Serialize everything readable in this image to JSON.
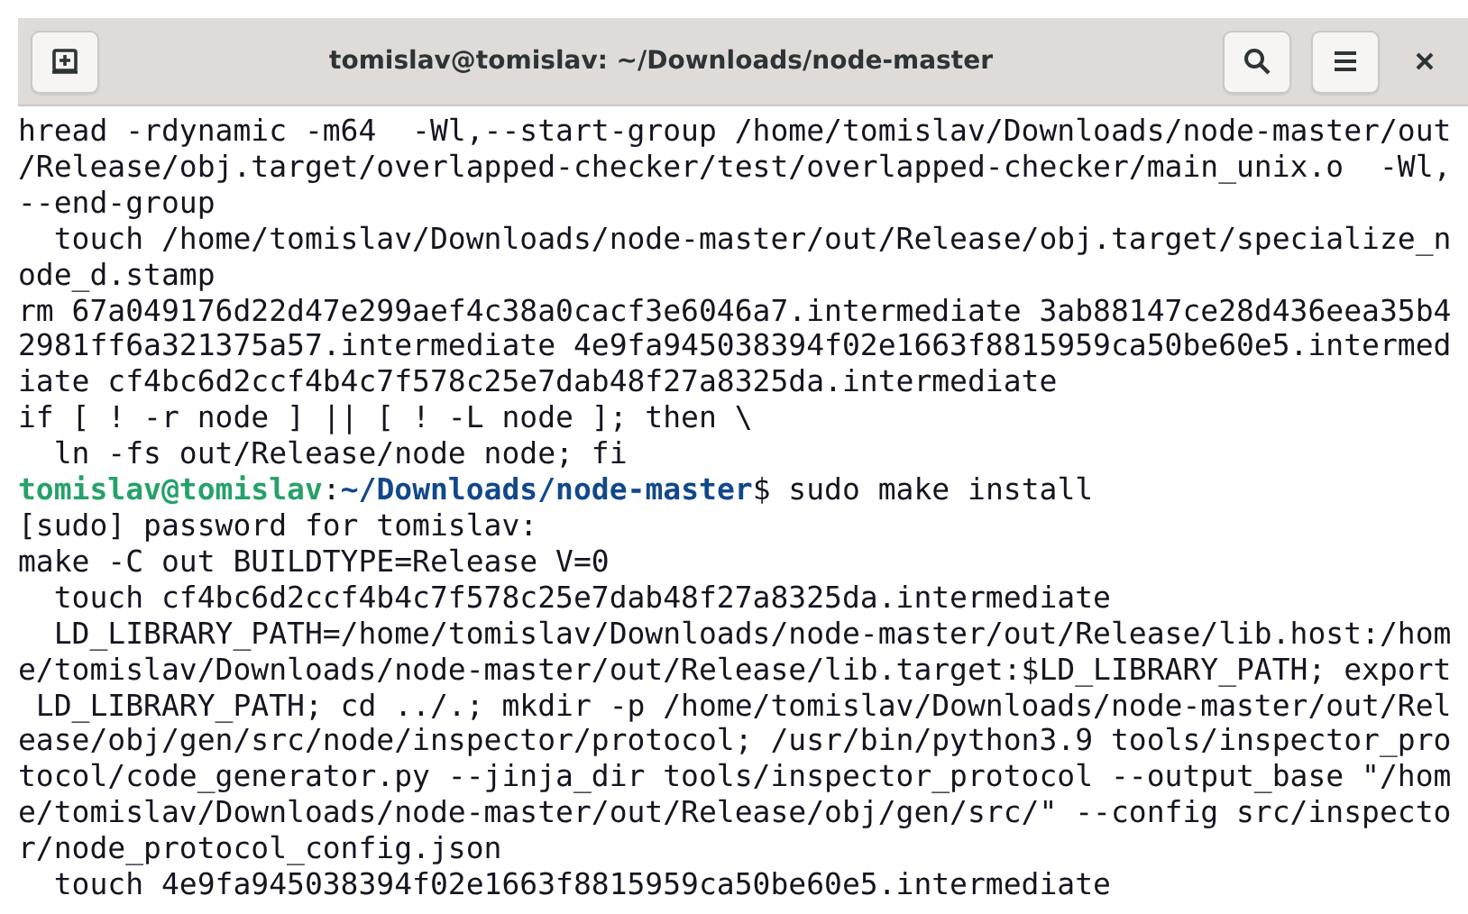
{
  "window": {
    "title": "tomislav@tomislav: ~/Downloads/node-master"
  },
  "terminal": {
    "rows": [
      {
        "kind": "output",
        "text": "hread -rdynamic -m64  -Wl,--start-group /home/tomislav/Downloads/node-master/out"
      },
      {
        "kind": "output",
        "text": "/Release/obj.target/overlapped-checker/test/overlapped-checker/main_unix.o  -Wl,"
      },
      {
        "kind": "output",
        "text": "--end-group"
      },
      {
        "kind": "output",
        "text": "  touch /home/tomislav/Downloads/node-master/out/Release/obj.target/specialize_n"
      },
      {
        "kind": "output",
        "text": "ode_d.stamp"
      },
      {
        "kind": "output",
        "text": "rm 67a049176d22d47e299aef4c38a0cacf3e6046a7.intermediate 3ab88147ce28d436eea35b4"
      },
      {
        "kind": "output",
        "text": "2981ff6a321375a57.intermediate 4e9fa945038394f02e1663f8815959ca50be60e5.intermed"
      },
      {
        "kind": "output",
        "text": "iate cf4bc6d2ccf4b4c7f578c25e7dab48f27a8325da.intermediate"
      },
      {
        "kind": "output",
        "text": "if [ ! -r node ] || [ ! -L node ]; then \\"
      },
      {
        "kind": "output",
        "text": "  ln -fs out/Release/node node; fi"
      },
      {
        "kind": "prompt",
        "user_host": "tomislav@tomislav",
        "separator": ":",
        "path": "~/Downloads/node-master",
        "command": "$ sudo make install"
      },
      {
        "kind": "output",
        "text": "[sudo] password for tomislav:"
      },
      {
        "kind": "output",
        "text": "make -C out BUILDTYPE=Release V=0"
      },
      {
        "kind": "output",
        "text": "  touch cf4bc6d2ccf4b4c7f578c25e7dab48f27a8325da.intermediate"
      },
      {
        "kind": "output",
        "text": "  LD_LIBRARY_PATH=/home/tomislav/Downloads/node-master/out/Release/lib.host:/hom"
      },
      {
        "kind": "output",
        "text": "e/tomislav/Downloads/node-master/out/Release/lib.target:$LD_LIBRARY_PATH; export"
      },
      {
        "kind": "output",
        "text": " LD_LIBRARY_PATH; cd ../.; mkdir -p /home/tomislav/Downloads/node-master/out/Rel"
      },
      {
        "kind": "output",
        "text": "ease/obj/gen/src/node/inspector/protocol; /usr/bin/python3.9 tools/inspector_pro"
      },
      {
        "kind": "output",
        "text": "tocol/code_generator.py --jinja_dir tools/inspector_protocol --output_base \"/hom"
      },
      {
        "kind": "output",
        "text": "e/tomislav/Downloads/node-master/out/Release/obj/gen/src/\" --config src/inspecto"
      },
      {
        "kind": "output",
        "text": "r/node_protocol_config.json"
      },
      {
        "kind": "output",
        "text": "  touch 4e9fa945038394f02e1663f8815959ca50be60e5.intermediate"
      }
    ]
  }
}
